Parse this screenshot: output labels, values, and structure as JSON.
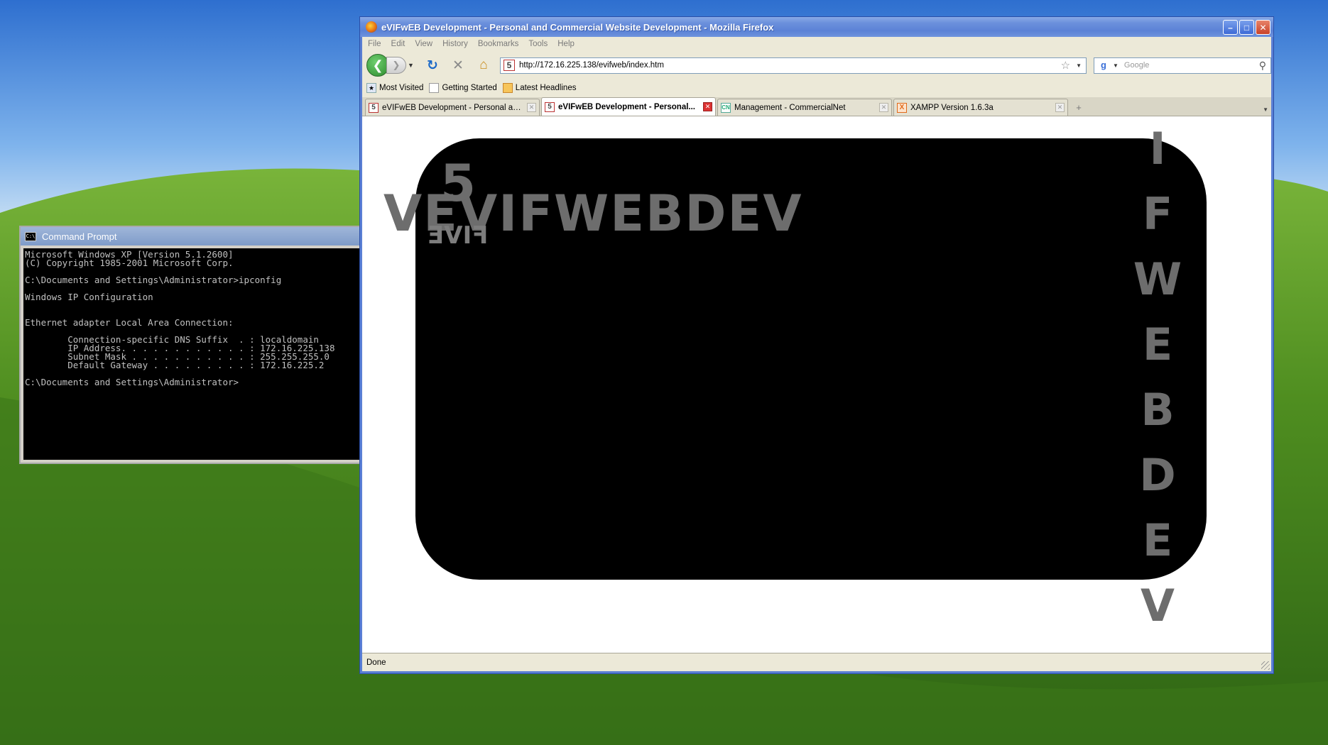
{
  "desktop": {
    "background": "#4e8a1d"
  },
  "cmd": {
    "title": "Command Prompt",
    "lines": [
      "Microsoft Windows XP [Version 5.1.2600]",
      "(C) Copyright 1985-2001 Microsoft Corp.",
      "",
      "C:\\Documents and Settings\\Administrator>ipconfig",
      "",
      "Windows IP Configuration",
      "",
      "",
      "Ethernet adapter Local Area Connection:",
      "",
      "        Connection-specific DNS Suffix  . : localdomain",
      "        IP Address. . . . . . . . . . . . : 172.16.225.138",
      "        Subnet Mask . . . . . . . . . . . : 255.255.255.0",
      "        Default Gateway . . . . . . . . . : 172.16.225.2",
      "",
      "C:\\Documents and Settings\\Administrator>"
    ]
  },
  "firefox": {
    "title": "eVIFwEB Development - Personal and Commercial Website Development - Mozilla Firefox",
    "menu": [
      "File",
      "Edit",
      "View",
      "History",
      "Bookmarks",
      "Tools",
      "Help"
    ],
    "url": "http://172.16.225.138/evifweb/index.htm",
    "search_placeholder": "Google",
    "bookmarks": [
      "Most Visited",
      "Getting Started",
      "Latest Headlines"
    ],
    "tabs": [
      {
        "label": "eVIFwEB Development - Personal and ...",
        "icon": "5",
        "active": false
      },
      {
        "label": "eVIFwEB Development - Personal...",
        "icon": "5",
        "active": true
      },
      {
        "label": "Management - CommercialNet",
        "icon": "CN",
        "active": false
      },
      {
        "label": "XAMPP Version 1.6.3a",
        "icon": "X",
        "active": false
      }
    ],
    "status": "Done"
  },
  "page": {
    "banner_horizontal": "VEVIFWEBDEV",
    "banner_vertical": [
      "I",
      "F",
      "W",
      "E",
      "B",
      "D",
      "E",
      "V"
    ],
    "logo_number": "5",
    "logo_mirror": "FIVE"
  }
}
